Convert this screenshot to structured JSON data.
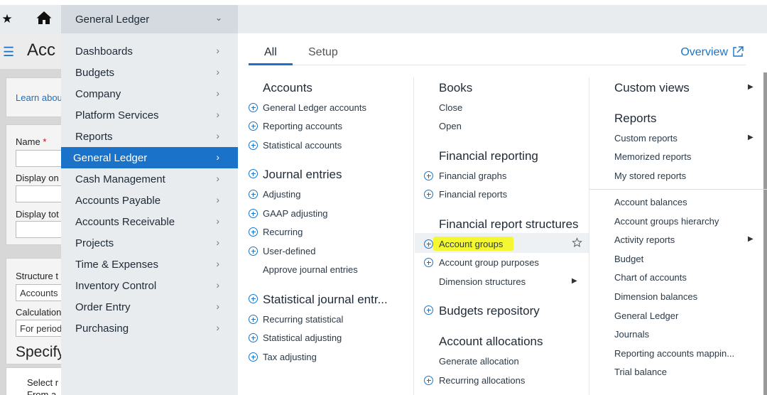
{
  "topbar": {
    "star_icon": "star-icon",
    "home_icon": "home-icon",
    "module_dropdown": "General Ledger",
    "chevron_icon": "chevron-down-icon"
  },
  "background_page": {
    "title": "Acc",
    "learn_link": "Learn abou",
    "name_label": "Name",
    "required_mark": "*",
    "display_on_label": "Display on",
    "display_tot_label": "Display tot",
    "structure_label": "Structure t",
    "structure_value": "Accounts",
    "calculation_label": "Calculation",
    "calculation_value": "For period",
    "specify_heading": "Specify",
    "select_text": "Select r",
    "from_text": "From a"
  },
  "menu": {
    "items": [
      {
        "label": "Dashboards"
      },
      {
        "label": "Budgets"
      },
      {
        "label": "Company"
      },
      {
        "label": "Platform Services"
      },
      {
        "label": "Reports"
      },
      {
        "label": "General Ledger",
        "active": true
      },
      {
        "label": "Cash Management"
      },
      {
        "label": "Accounts Payable"
      },
      {
        "label": "Accounts Receivable"
      },
      {
        "label": "Projects"
      },
      {
        "label": "Time & Expenses"
      },
      {
        "label": "Inventory Control"
      },
      {
        "label": "Order Entry"
      },
      {
        "label": "Purchasing"
      }
    ]
  },
  "panel": {
    "tabs": [
      "All",
      "Setup"
    ],
    "active_tab": "All",
    "overview_link": "Overview",
    "col1": {
      "accounts_h": "Accounts",
      "accounts": [
        "General Ledger accounts",
        "Reporting accounts",
        "Statistical accounts"
      ],
      "journal_h": "Journal entries",
      "journal": [
        "Adjusting",
        "GAAP adjusting",
        "Recurring",
        "User-defined",
        "Approve journal entries"
      ],
      "stat_h": "Statistical journal entr...",
      "stat": [
        "Recurring statistical",
        "Statistical adjusting",
        "Tax adjusting"
      ]
    },
    "col2": {
      "books_h": "Books",
      "books": [
        "Close",
        "Open"
      ],
      "fin_rep_h": "Financial reporting",
      "fin_rep": [
        "Financial graphs",
        "Financial reports"
      ],
      "structures_h": "Financial report structures",
      "structures": [
        "Account groups",
        "Account group purposes",
        "Dimension structures"
      ],
      "budgets_h": "Budgets repository",
      "alloc_h": "Account allocations",
      "alloc": [
        "Generate allocation",
        "Recurring allocations"
      ]
    },
    "col3": {
      "custom_views_h": "Custom views",
      "reports_h": "Reports",
      "reports": [
        "Custom reports",
        "Memorized reports",
        "My stored reports"
      ],
      "report_list": [
        "Account balances",
        "Account groups hierarchy",
        "Activity reports",
        "Budget",
        "Chart of accounts",
        "Dimension balances",
        "General Ledger",
        "Journals",
        "Reporting accounts mappin...",
        "Trial balance"
      ]
    },
    "highlight_color": "#f4f731",
    "accent_color": "#1a73c8"
  }
}
